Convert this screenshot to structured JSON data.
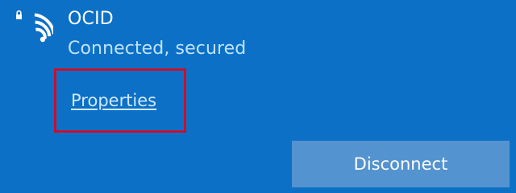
{
  "network": {
    "name": "OCID",
    "status": "Connected, secured",
    "icon": "wifi-secured-icon"
  },
  "actions": {
    "properties_label": "Properties",
    "disconnect_label": "Disconnect"
  },
  "colors": {
    "panel_background": "#0c70c7",
    "status_text": "#bfe3ff",
    "link_text": "#cfe8ff",
    "button_background": "#5393cf",
    "highlight_border": "#c8102e"
  }
}
